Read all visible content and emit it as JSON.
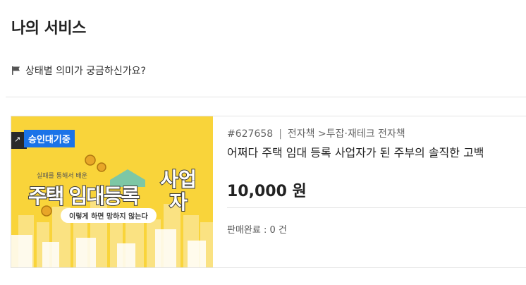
{
  "header": {
    "title": "나의 서비스",
    "status_help_label": "상태별 의미가 궁금하신가요?"
  },
  "card": {
    "badge": "승인대기중",
    "thumbnail": {
      "small_text": "실패를 통해서 배운",
      "main_text": "주택 임대등록",
      "side_text": "사업 자",
      "sub_text": "이렇게 하면 망하지 않는다"
    },
    "item_id": "#627658",
    "category": "전자책",
    "subcategory": ">투잡·재테크 전자책",
    "title": "어쩌다 주택 임대 등록 사업자가 된 주부의 솔직한 고백",
    "price": "10,000 원",
    "sales": "판매완료 : 0 건"
  },
  "colors": {
    "badge_bg": "#1a73e8",
    "thumb_bg": "#f9d43a"
  },
  "icons": {
    "status_help": "flag-icon"
  }
}
